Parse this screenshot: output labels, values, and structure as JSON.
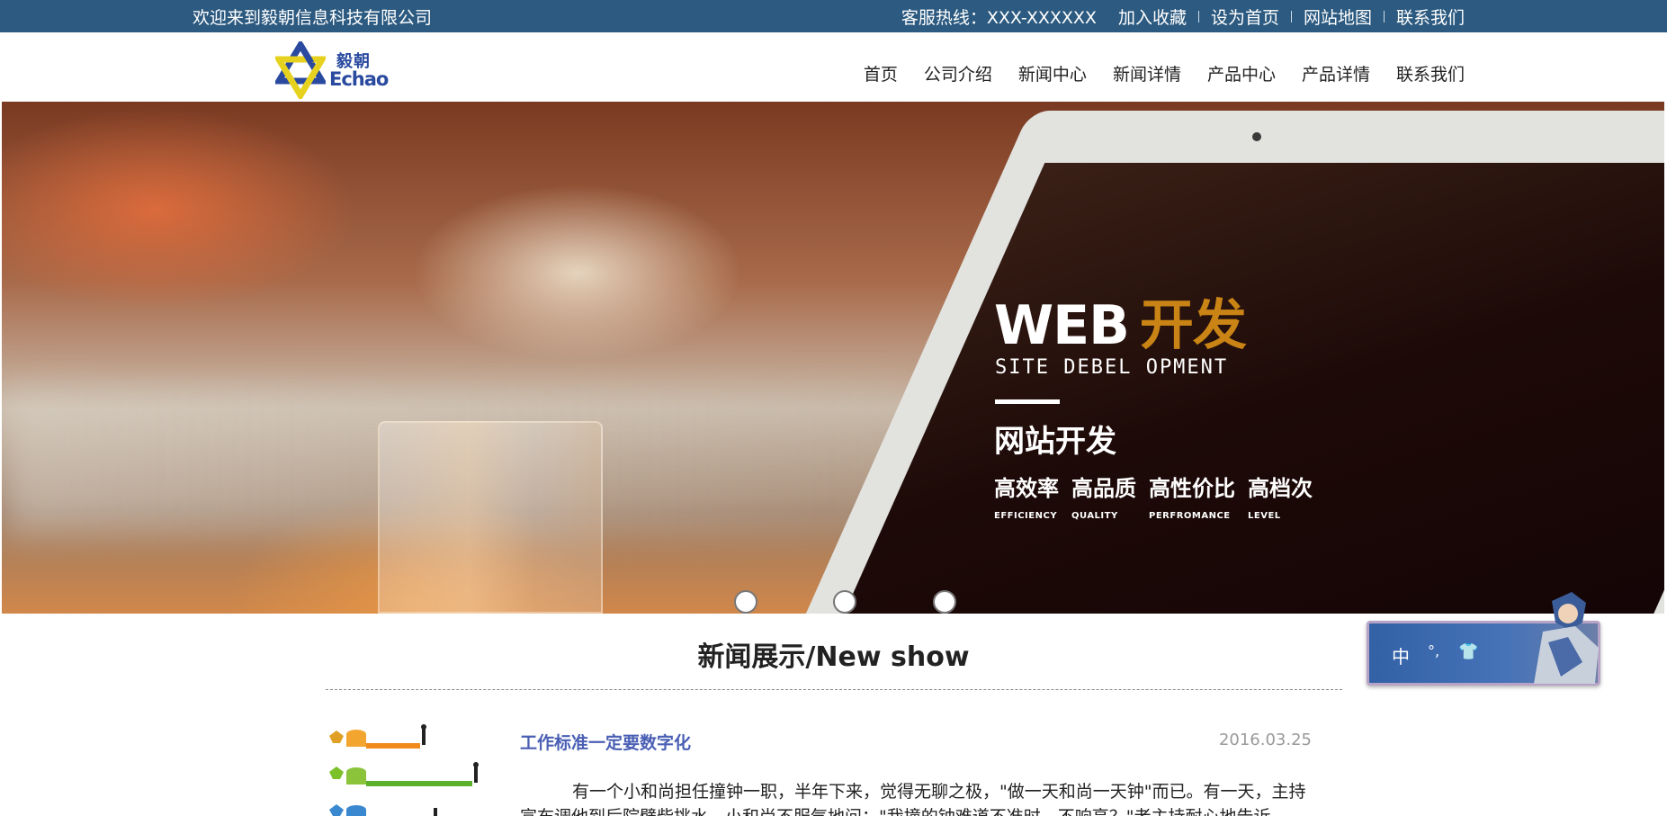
{
  "topbar": {
    "welcome": "欢迎来到毅朝信息科技有限公司",
    "hotline": "客服热线：XXX-XXXXXX",
    "links": [
      "加入收藏",
      "设为首页",
      "网站地图",
      "联系我们"
    ]
  },
  "logo": {
    "cn": "毅朝",
    "en": "Echao"
  },
  "nav": [
    "首页",
    "公司介绍",
    "新闻中心",
    "新闻详情",
    "产品中心",
    "产品详情",
    "联系我们"
  ],
  "banner": {
    "title_white": "WEB",
    "title_accent": "开发",
    "subtitle": "SITE DEBEL OPMENT",
    "heading": "网站开发",
    "tags": [
      {
        "zh": "高效率",
        "en": "EFFICIENCY"
      },
      {
        "zh": "高品质",
        "en": "QUALITY"
      },
      {
        "zh": "高性价比",
        "en": "PERFROMANCE"
      },
      {
        "zh": "高档次",
        "en": "LEVEL"
      }
    ],
    "slides": 3,
    "accent_color": "#c98415"
  },
  "news": {
    "section_title": "新闻展示/New show",
    "items": [
      {
        "title": "工作标准一定要数字化",
        "date": "2016.03.25",
        "body": "有一个小和尚担任撞钟一职，半年下来，觉得无聊之极，\"做一天和尚一天钟\"而已。有一天，主持宣布调他到后院劈柴挑水，小和尚不服气地问：\"我撞的钟难道不准时、不响亮？\"老主持耐心地告诉"
      }
    ]
  },
  "widget": {
    "buttons": [
      "中",
      "°,",
      "👕"
    ]
  },
  "colors": {
    "topbar": "#2c5a80",
    "link": "#4a5fb4",
    "date": "#999999"
  }
}
